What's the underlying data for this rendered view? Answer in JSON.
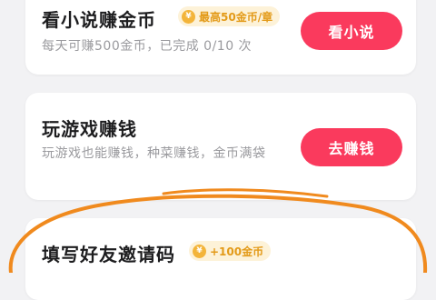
{
  "tasks": [
    {
      "title": "看小说赚金币",
      "badge": "最高50金币/章",
      "desc": "每天可赚500金币，已完成 0/10 次",
      "button": "看小说"
    },
    {
      "title": "玩游戏赚钱",
      "desc": "玩游戏也能赚钱，种菜赚钱，金币满袋",
      "button": "去赚钱"
    },
    {
      "title": "填写好友邀请码",
      "badge": "+100金币"
    }
  ],
  "coin_symbol": "¥",
  "colors": {
    "accent": "#fa3a5d",
    "badge_text": "#e39a18",
    "badge_bg": "#fdf2d8",
    "annotation_stroke": "#f08a1e"
  }
}
